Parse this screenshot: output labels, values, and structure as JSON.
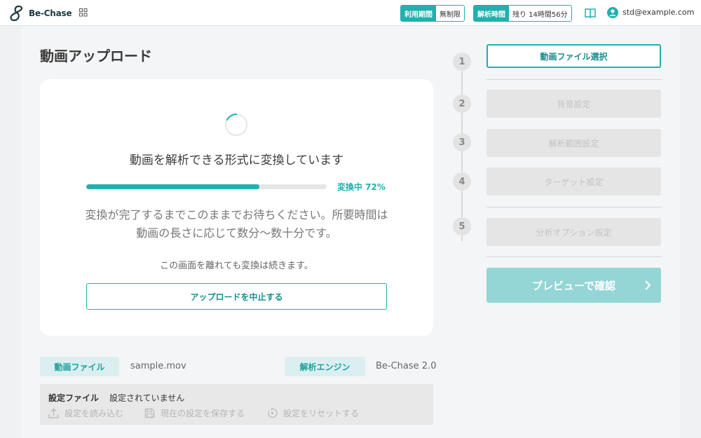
{
  "header": {
    "logo_text": "Be-Chase",
    "usage_key": "利用期間",
    "usage_value": "無制限",
    "analysis_key": "解析時間",
    "analysis_value": "残り 14時間56分",
    "user_email": "std@example.com"
  },
  "page": {
    "title": "動画アップロード"
  },
  "card": {
    "title": "動画を解析できる形式に変換しています",
    "progress_percent": 72,
    "progress_label": "変換中 72%",
    "description": "変換が完了するまでこのままでお待ちください。所要時間は動画の長さに応じて数分〜数十分です。",
    "note": "この画面を離れても変換は続きます。",
    "cancel_label": "アップロードを中止する"
  },
  "file_info": {
    "video_file_label": "動画ファイル",
    "video_file_value": "sample.mov",
    "engine_label": "解析エンジン",
    "engine_value": "Be-Chase 2.0"
  },
  "settings": {
    "label": "設定ファイル",
    "value": "設定されていません",
    "load_label": "設定を読み込む",
    "save_label": "現在の設定を保存する",
    "reset_label": "設定をリセットする"
  },
  "steps": [
    {
      "num": "1",
      "label": "動画ファイル選択"
    },
    {
      "num": "2",
      "label": "背景設定"
    },
    {
      "num": "3",
      "label": "解析範囲設定"
    },
    {
      "num": "4",
      "label": "ターゲット設定"
    },
    {
      "num": "5",
      "label": "分析オプション設定"
    }
  ],
  "preview_label": "プレビューで確認",
  "colors": {
    "accent": "#21b0ae",
    "accent_light": "#dceff0",
    "preview_disabled": "#93d6d5"
  }
}
